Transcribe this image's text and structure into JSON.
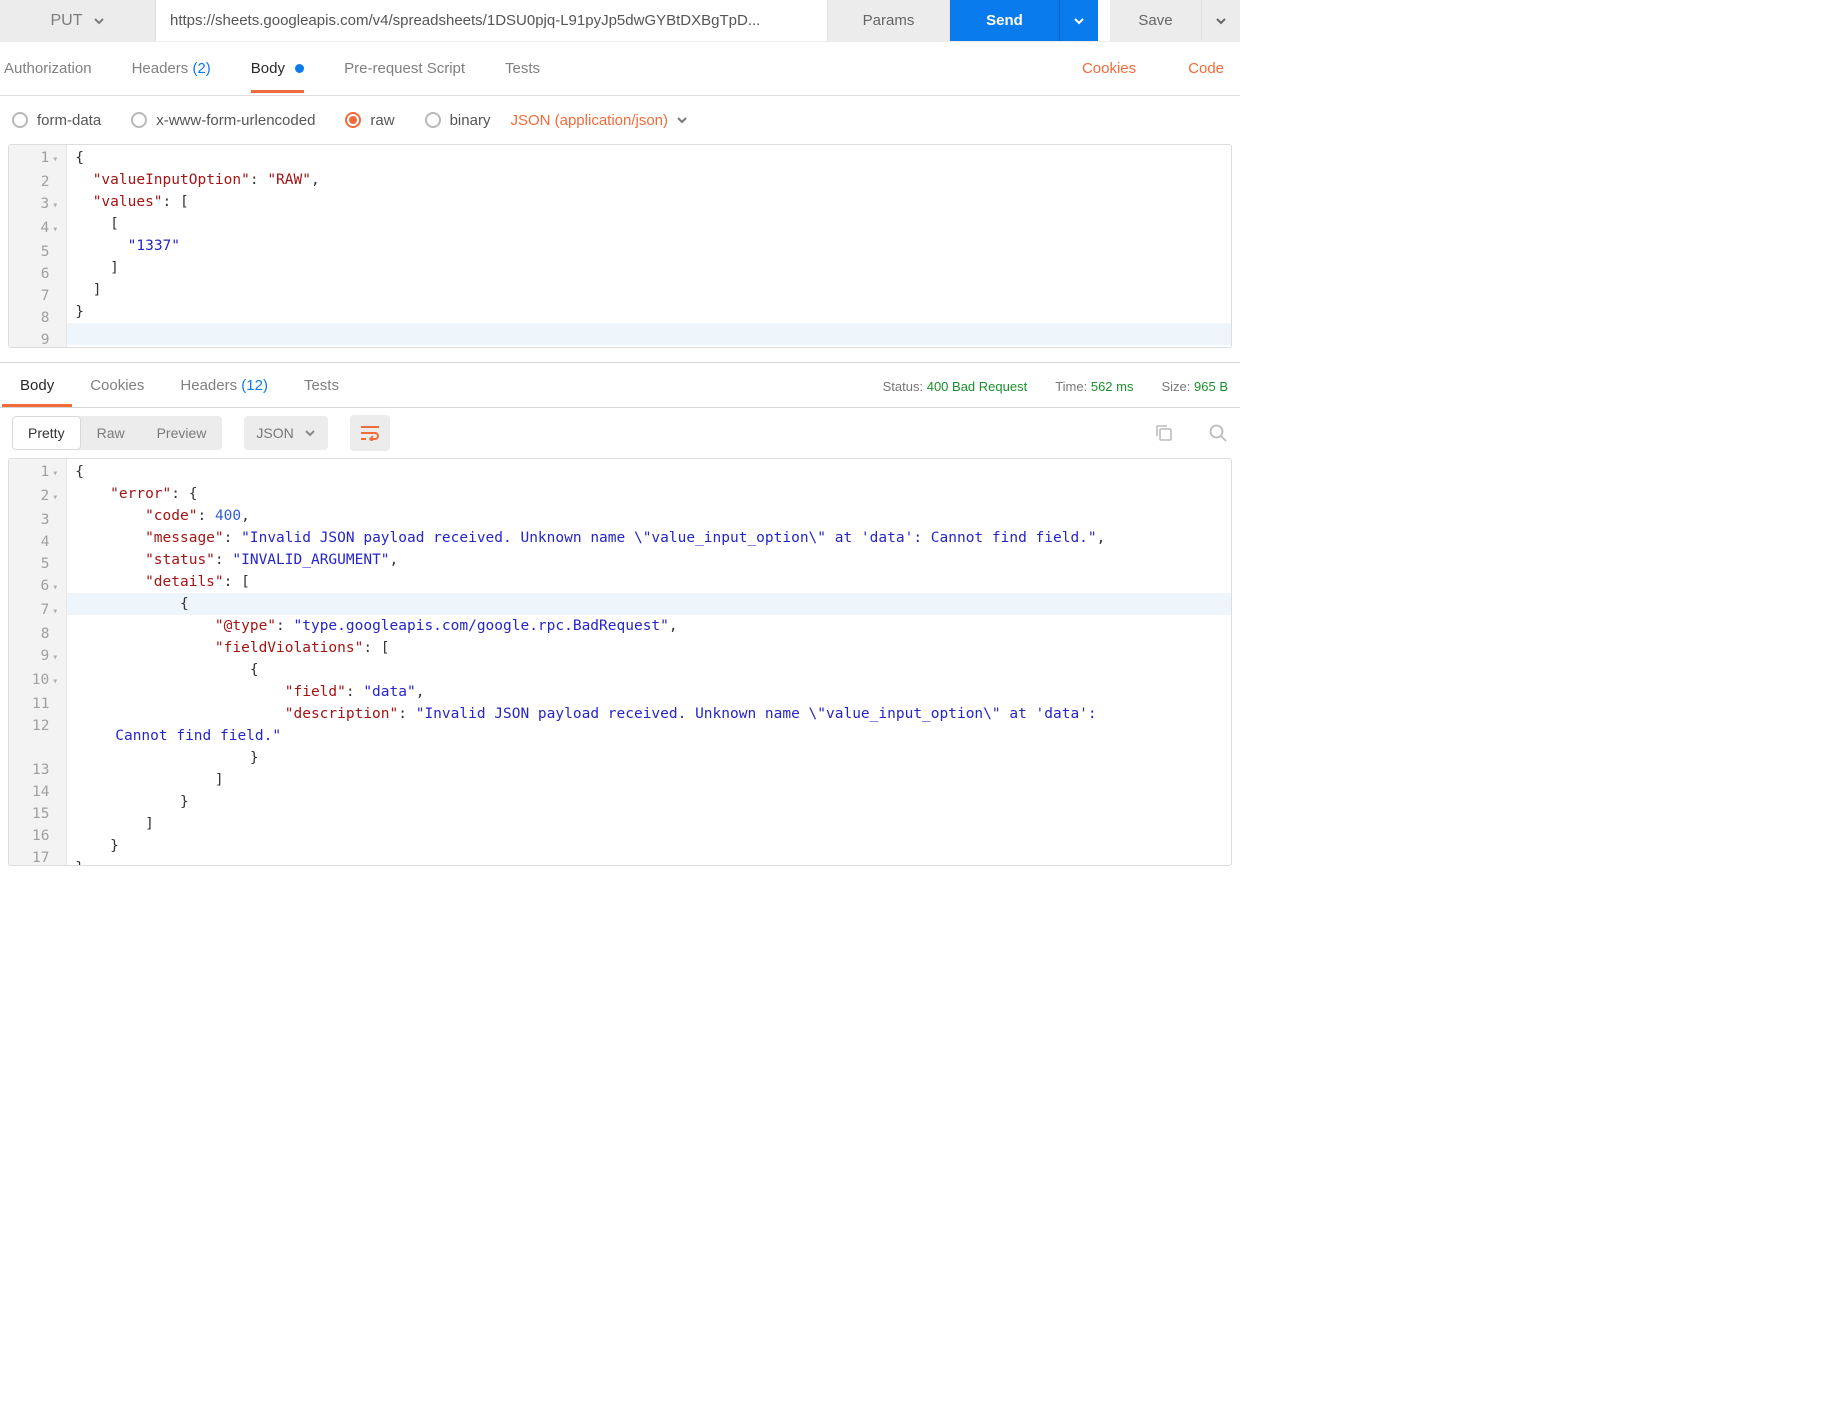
{
  "request": {
    "method": "PUT",
    "url": "https://sheets.googleapis.com/v4/spreadsheets/1DSU0pjq-L91pyJp5dwGYBtDXBgTpD...",
    "params_btn": "Params",
    "send_btn": "Send",
    "save_btn": "Save",
    "tabs": {
      "auth": "Authorization",
      "headers": "Headers",
      "headers_count": "(2)",
      "body": "Body",
      "prereq": "Pre-request Script",
      "tests": "Tests"
    },
    "links": {
      "cookies": "Cookies",
      "code": "Code"
    },
    "body_opts": {
      "form": "form-data",
      "urlencoded": "x-www-form-urlencoded",
      "raw": "raw",
      "binary": "binary",
      "content_type": "JSON (application/json)"
    },
    "body_lines": {
      "l1": "{",
      "l2_key": "\"valueInputOption\"",
      "l2_val": "\"RAW\"",
      "l3_key": "\"values\"",
      "l5_val": "\"1337\"",
      "l8": "}"
    }
  },
  "response": {
    "tabs": {
      "body": "Body",
      "cookies": "Cookies",
      "headers": "Headers",
      "headers_count": "(12)",
      "tests": "Tests"
    },
    "meta": {
      "status_label": "Status:",
      "status": "400 Bad Request",
      "time_label": "Time:",
      "time": "562 ms",
      "size_label": "Size:",
      "size": "965 B"
    },
    "view": {
      "pretty": "Pretty",
      "raw": "Raw",
      "preview": "Preview",
      "format": "JSON"
    },
    "body_lines": {
      "l2_key": "\"error\"",
      "l3_key": "\"code\"",
      "l3_val": "400",
      "l4_key": "\"message\"",
      "l4_val": "\"Invalid JSON payload received. Unknown name \\\"value_input_option\\\" at 'data': Cannot find field.\"",
      "l5_key": "\"status\"",
      "l5_val": "\"INVALID_ARGUMENT\"",
      "l6_key": "\"details\"",
      "l8_key": "\"@type\"",
      "l8_val": "\"type.googleapis.com/google.rpc.BadRequest\"",
      "l9_key": "\"fieldViolations\"",
      "l11_key": "\"field\"",
      "l11_val": "\"data\"",
      "l12_key": "\"description\"",
      "l12_val": "\"Invalid JSON payload received. Unknown name \\\"value_input_option\\\" at 'data': ",
      "l12_wrap": "Cannot find field.\""
    }
  }
}
